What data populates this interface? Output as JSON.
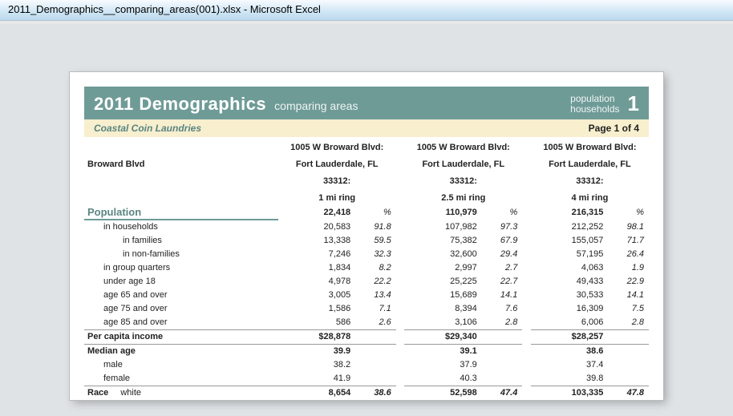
{
  "window": {
    "title": "2011_Demographics__comparing_areas(001).xlsx - Microsoft Excel"
  },
  "banner": {
    "title": "2011 Demographics",
    "subtitle": "comparing areas",
    "right_line1": "population",
    "right_line2": "households",
    "page_no": "1"
  },
  "subbar": {
    "left": "Coastal Coin Laundries",
    "right": "Page 1 of 4"
  },
  "site_row_label": "Broward Blvd",
  "sites": [
    {
      "addr1": "1005 W Broward Blvd:",
      "addr2": "Fort Lauderdale, FL",
      "addr3": "33312:",
      "ring": "1 mi ring"
    },
    {
      "addr1": "1005 W Broward Blvd:",
      "addr2": "Fort Lauderdale, FL",
      "addr3": "33312:",
      "ring": "2.5 mi ring"
    },
    {
      "addr1": "1005 W Broward Blvd:",
      "addr2": "Fort Lauderdale, FL",
      "addr3": "33312:",
      "ring": "4 mi ring"
    }
  ],
  "section_pop": {
    "label": "Population",
    "totals": [
      "22,418",
      "110,979",
      "216,315"
    ],
    "pct_label": "%",
    "rows": [
      {
        "label": "in households",
        "indent": 1,
        "v": [
          "20,583",
          "107,982",
          "212,252"
        ],
        "p": [
          "91.8",
          "97.3",
          "98.1"
        ]
      },
      {
        "label": "in families",
        "indent": 2,
        "v": [
          "13,338",
          "75,382",
          "155,057"
        ],
        "p": [
          "59.5",
          "67.9",
          "71.7"
        ]
      },
      {
        "label": "in non-families",
        "indent": 2,
        "v": [
          "7,246",
          "32,600",
          "57,195"
        ],
        "p": [
          "32.3",
          "29.4",
          "26.4"
        ]
      },
      {
        "label": "in group quarters",
        "indent": 1,
        "v": [
          "1,834",
          "2,997",
          "4,063"
        ],
        "p": [
          "8.2",
          "2.7",
          "1.9"
        ]
      },
      {
        "label": "under age 18",
        "indent": 1,
        "v": [
          "4,978",
          "25,225",
          "49,433"
        ],
        "p": [
          "22.2",
          "22.7",
          "22.9"
        ]
      },
      {
        "label": "age 65 and over",
        "indent": 1,
        "v": [
          "3,005",
          "15,689",
          "30,533"
        ],
        "p": [
          "13.4",
          "14.1",
          "14.1"
        ]
      },
      {
        "label": "age 75 and over",
        "indent": 1,
        "v": [
          "1,586",
          "8,394",
          "16,309"
        ],
        "p": [
          "7.1",
          "7.6",
          "7.5"
        ]
      },
      {
        "label": "age 85 and over",
        "indent": 1,
        "v": [
          "586",
          "3,106",
          "6,006"
        ],
        "p": [
          "2.6",
          "2.8",
          "2.8"
        ]
      }
    ]
  },
  "pci": {
    "label": "Per capita income",
    "v": [
      "$28,878",
      "$29,340",
      "$28,257"
    ]
  },
  "median": {
    "label": "Median age",
    "v": [
      "39.9",
      "39.1",
      "38.6"
    ],
    "rows": [
      {
        "label": "male",
        "v": [
          "38.2",
          "37.9",
          "37.4"
        ]
      },
      {
        "label": "female",
        "v": [
          "41.9",
          "40.3",
          "39.8"
        ]
      }
    ]
  },
  "race": {
    "label": "Race",
    "sub": "white",
    "v": [
      "8,654",
      "52,598",
      "103,335"
    ],
    "p": [
      "38.6",
      "47.4",
      "47.8"
    ]
  }
}
